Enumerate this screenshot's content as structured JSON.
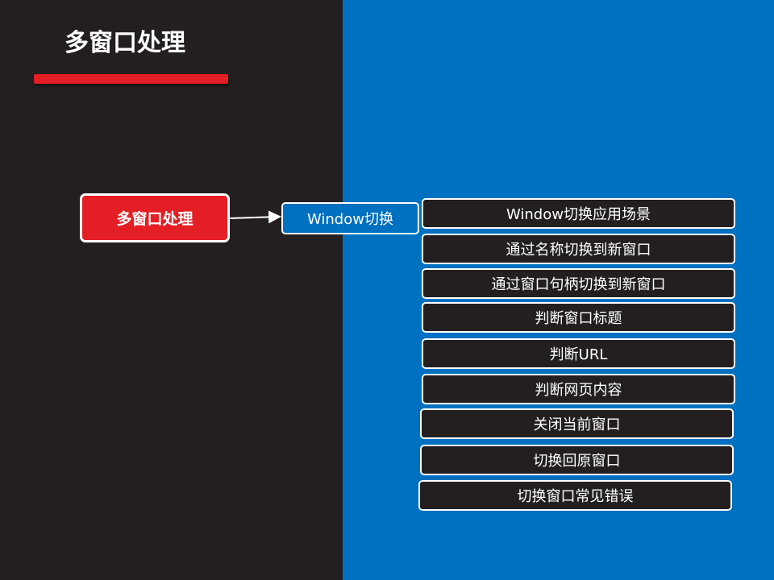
{
  "slide": {
    "title": "多窗口处理",
    "colors": {
      "left_background": "#231f20",
      "right_background": "#0070c0",
      "accent_red": "#e31e24",
      "text": "#ffffff"
    }
  },
  "mindmap": {
    "root": "多窗口处理",
    "child": "Window切换",
    "branches": [
      "Window切换应用场景",
      "通过名称切换到新窗口",
      "通过窗口句柄切换到新窗口",
      "判断窗口标题",
      "判断URL",
      "判断网页内容",
      "关闭当前窗口",
      "切换回原窗口",
      "切换窗口常见错误"
    ]
  }
}
